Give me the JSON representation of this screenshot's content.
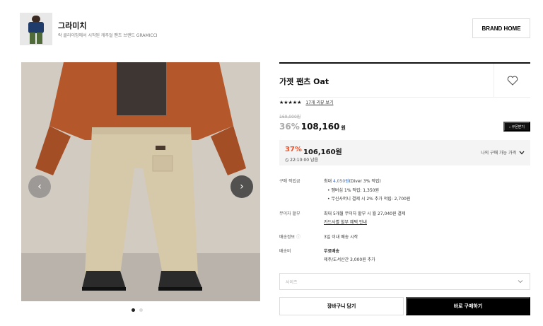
{
  "brand": {
    "name": "그라미치",
    "description": "락 클라이밍에서 시작된 캐주얼 팬츠 브랜드 GRAMICCI",
    "home_label": "BRAND HOME"
  },
  "product": {
    "title": "가젯 팬츠 Oat",
    "stars": "★★★★★",
    "rating": 5,
    "review_link": "17개 리뷰 보기",
    "original_price": "169,000원",
    "discount_rate": "36%",
    "sale_price": "108,160",
    "currency": "원",
    "coupon_label": "↓ 쿠폰받기"
  },
  "special_price": {
    "rate": "37%",
    "price": "106,160원",
    "time_left": "◷ 22:10:00 남음",
    "my_price_label": "나의 구매 가능 가격"
  },
  "details": {
    "points_label": "구매 적립금",
    "points_prefix": "최대 ",
    "points_amount": "4,050원",
    "points_suffix": "(Diver 3% 적립)",
    "points_item1": "• 멤버십 1% 적립: 1,350원",
    "points_item2": "• 무신사머니 결제 시 2% 추가 적립: 2,700원",
    "installment_label": "무이자 할부",
    "installment_text": "최대 5개월 무이자 할부 시 월 27,040원 결제",
    "installment_link": "카드사별 할부 혜택 안내",
    "shipping_label": "배송정보",
    "shipping_text": "3일 이내 배송 시작",
    "fee_label": "배송비",
    "fee_text": "무료배송",
    "fee_sub": "제주/도서산간 3,000원 추가"
  },
  "actions": {
    "size_placeholder": "사이즈",
    "cart_label": "장바구니 담기",
    "buy_label": "바로 구매하기"
  },
  "gallery": {
    "current_slide": 1,
    "total_slides": 2
  },
  "colors": {
    "accent_orange": "#ff4a1c",
    "link_blue": "#2b6fea",
    "buy_button": "#000000"
  }
}
